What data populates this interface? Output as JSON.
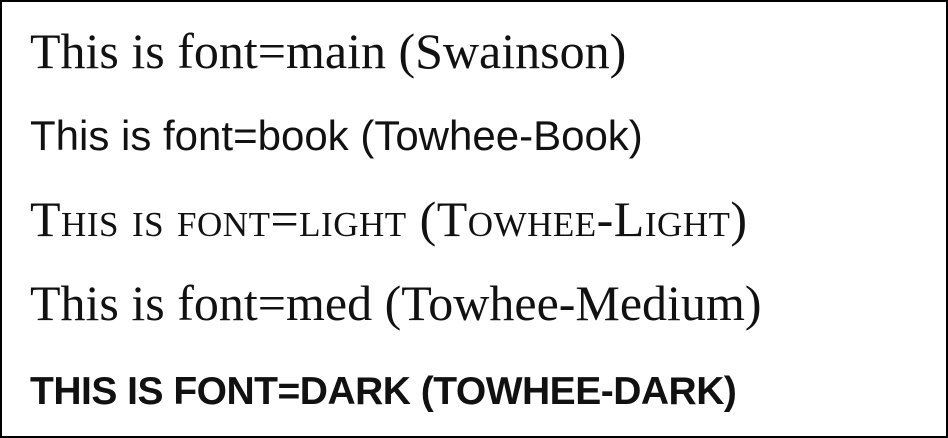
{
  "samples": [
    {
      "text": "This is font=main (Swainson)"
    },
    {
      "text": "This is font=book (Towhee-Book)"
    },
    {
      "text": "This is font=light (Towhee-Light)"
    },
    {
      "text": "This is font=med (Towhee-Medium)"
    },
    {
      "text": "THIS IS FONT=DARK (TOWHEE-DARK)"
    }
  ]
}
